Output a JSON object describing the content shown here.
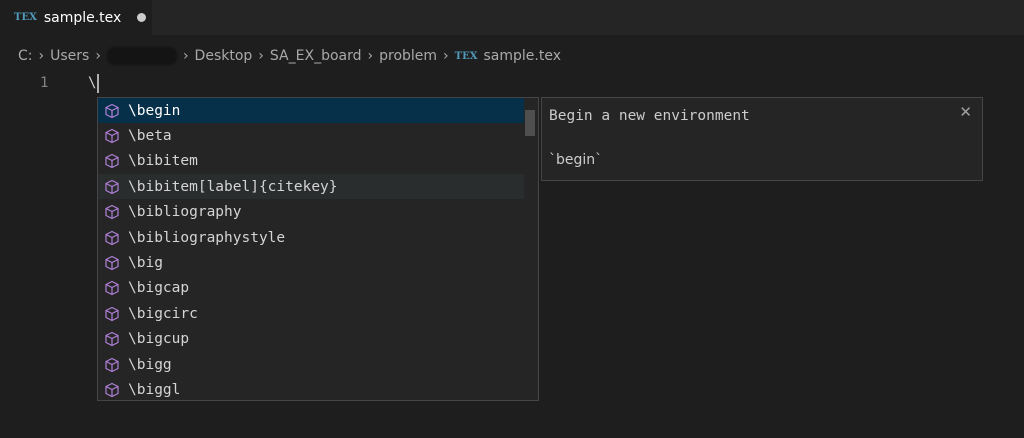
{
  "tab": {
    "icon": "tex-file-icon",
    "icon_text": "TEX",
    "label": "sample.tex",
    "dirty": true
  },
  "breadcrumb": {
    "items": [
      "C:",
      "Users",
      "",
      "Desktop",
      "SA_EX_board",
      "problem"
    ],
    "file_icon_text": "TEX",
    "file": "sample.tex"
  },
  "editor": {
    "line_number": "1",
    "line_text": "\\"
  },
  "suggest": {
    "selected_index": 0,
    "hover_index": 3,
    "item_icon": "cube-icon",
    "items": [
      "\\begin",
      "\\beta",
      "\\bibitem",
      "\\bibitem[label]{citekey}",
      "\\bibliography",
      "\\bibliographystyle",
      "\\big",
      "\\bigcap",
      "\\bigcirc",
      "\\bigcup",
      "\\bigg",
      "\\biggl"
    ]
  },
  "details": {
    "description": "Begin a new environment",
    "documentation": "`begin`",
    "close_glyph": "✕"
  },
  "colors": {
    "selected": "#062f4a",
    "cube_icon": "#b180d7",
    "tex_icon": "#519aba"
  }
}
